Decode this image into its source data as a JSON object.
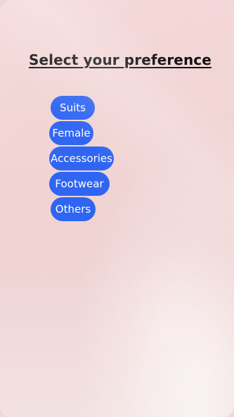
{
  "header": {
    "title": "Select your preference"
  },
  "preferences": [
    {
      "label": "Suits"
    },
    {
      "label": "Female"
    },
    {
      "label": "Accessories"
    },
    {
      "label": "Footwear"
    },
    {
      "label": "Others"
    }
  ],
  "colors": {
    "button_bg": "#2f65f2",
    "button_text": "#ffffff",
    "background": "#f2d6d6"
  }
}
